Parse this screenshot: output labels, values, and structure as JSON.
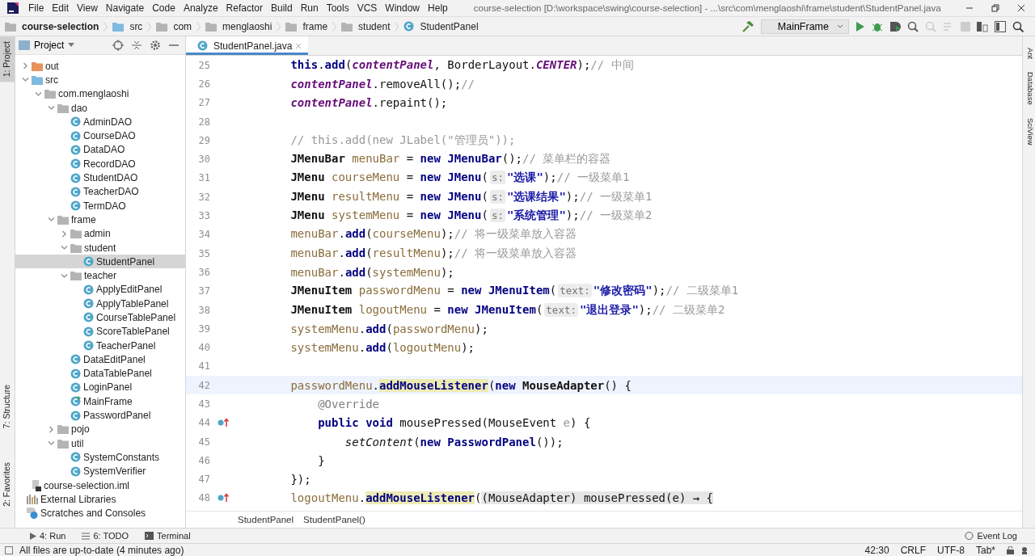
{
  "window": {
    "title": "course-selection [D:\\workspace\\swing\\course-selection] - ...\\src\\com\\menglaoshi\\frame\\student\\StudentPanel.java"
  },
  "menu": [
    "File",
    "Edit",
    "View",
    "Navigate",
    "Code",
    "Analyze",
    "Refactor",
    "Build",
    "Run",
    "Tools",
    "VCS",
    "Window",
    "Help"
  ],
  "breadcrumbs": [
    {
      "label": "course-selection",
      "kind": "project"
    },
    {
      "label": "src",
      "kind": "source"
    },
    {
      "label": "com",
      "kind": "folder"
    },
    {
      "label": "menglaoshi",
      "kind": "folder"
    },
    {
      "label": "frame",
      "kind": "folder"
    },
    {
      "label": "student",
      "kind": "folder"
    },
    {
      "label": "StudentPanel",
      "kind": "class"
    }
  ],
  "run_config": {
    "label": "MainFrame"
  },
  "left_stripe": [
    {
      "label": "1: Project",
      "selected": true
    },
    {
      "label": "7: Structure",
      "selected": false
    },
    {
      "label": "2: Favorites",
      "selected": false
    }
  ],
  "right_stripe": [
    "Ant",
    "Database",
    "SciView"
  ],
  "project_panel": {
    "title": "Project"
  },
  "project_tree": {
    "items": [
      {
        "label": "out",
        "kind": "excluded",
        "expanded": false,
        "selected": false
      },
      {
        "label": "src",
        "kind": "source",
        "expanded": true,
        "selected": false,
        "children": [
          {
            "label": "com.menglaoshi",
            "kind": "package",
            "expanded": true,
            "selected": false,
            "children": [
              {
                "label": "dao",
                "kind": "package",
                "expanded": true,
                "selected": false,
                "children": [
                  {
                    "label": "AdminDAO",
                    "kind": "class",
                    "selected": false
                  },
                  {
                    "label": "CourseDAO",
                    "kind": "class",
                    "selected": false
                  },
                  {
                    "label": "DataDAO",
                    "kind": "class",
                    "selected": false
                  },
                  {
                    "label": "RecordDAO",
                    "kind": "class",
                    "selected": false
                  },
                  {
                    "label": "StudentDAO",
                    "kind": "class",
                    "selected": false
                  },
                  {
                    "label": "TeacherDAO",
                    "kind": "class",
                    "selected": false
                  },
                  {
                    "label": "TermDAO",
                    "kind": "class",
                    "selected": false
                  }
                ]
              },
              {
                "label": "frame",
                "kind": "package",
                "expanded": true,
                "selected": false,
                "children": [
                  {
                    "label": "admin",
                    "kind": "package",
                    "expanded": false,
                    "selected": false
                  },
                  {
                    "label": "student",
                    "kind": "package",
                    "expanded": true,
                    "selected": false,
                    "children": [
                      {
                        "label": "StudentPanel",
                        "kind": "class",
                        "selected": true
                      }
                    ]
                  },
                  {
                    "label": "teacher",
                    "kind": "package",
                    "expanded": true,
                    "selected": false,
                    "children": [
                      {
                        "label": "ApplyEditPanel",
                        "kind": "class",
                        "selected": false
                      },
                      {
                        "label": "ApplyTablePanel",
                        "kind": "class",
                        "selected": false
                      },
                      {
                        "label": "CourseTablePanel",
                        "kind": "class",
                        "selected": false
                      },
                      {
                        "label": "ScoreTablePanel",
                        "kind": "class",
                        "selected": false
                      },
                      {
                        "label": "TeacherPanel",
                        "kind": "class",
                        "selected": false
                      }
                    ]
                  },
                  {
                    "label": "DataEditPanel",
                    "kind": "class",
                    "selected": false
                  },
                  {
                    "label": "DataTablePanel",
                    "kind": "class",
                    "selected": false
                  },
                  {
                    "label": "LoginPanel",
                    "kind": "class",
                    "selected": false
                  },
                  {
                    "label": "MainFrame",
                    "kind": "main-class",
                    "selected": false
                  },
                  {
                    "label": "PasswordPanel",
                    "kind": "class",
                    "selected": false
                  }
                ]
              },
              {
                "label": "pojo",
                "kind": "package",
                "expanded": false,
                "selected": false
              },
              {
                "label": "util",
                "kind": "package",
                "expanded": true,
                "selected": false,
                "children": [
                  {
                    "label": "SystemConstants",
                    "kind": "class",
                    "selected": false
                  },
                  {
                    "label": "SystemVerifier",
                    "kind": "class",
                    "selected": false
                  }
                ]
              }
            ]
          }
        ]
      },
      {
        "label": "course-selection.iml",
        "kind": "module-file",
        "selected": false
      }
    ],
    "other_items": [
      {
        "label": "External Libraries",
        "kind": "libraries",
        "selected": false
      },
      {
        "label": "Scratches and Consoles",
        "kind": "scratches",
        "selected": false
      }
    ]
  },
  "editor_tabs": [
    {
      "label": "StudentPanel.java",
      "selected": true
    }
  ],
  "code": [
    {
      "number": "25",
      "tokens": [
        {
          "kind": "kw",
          "text": "        this"
        },
        {
          "kind": "plain",
          "text": "."
        },
        {
          "kind": "method",
          "text": "add"
        },
        {
          "kind": "plain",
          "text": "("
        },
        {
          "kind": "field",
          "text": "contentPanel"
        },
        {
          "kind": "plain",
          "text": ", BorderLayout."
        },
        {
          "kind": "field",
          "text": "CENTER"
        },
        {
          "kind": "plain",
          "text": ");"
        },
        {
          "kind": "comment",
          "text": "// 中间"
        }
      ]
    },
    {
      "number": "26",
      "tokens": [
        {
          "kind": "field",
          "text": "        contentPanel"
        },
        {
          "kind": "plain",
          "text": ".removeAll();"
        },
        {
          "kind": "comment",
          "text": "//"
        }
      ]
    },
    {
      "number": "27",
      "tokens": [
        {
          "kind": "field",
          "text": "        contentPanel"
        },
        {
          "kind": "plain",
          "text": ".repaint();"
        }
      ]
    },
    {
      "number": "28"
    },
    {
      "number": "29",
      "tokens": [
        {
          "kind": "comment",
          "text": "        // this.add(new JLabel(\"管理员\"));"
        }
      ]
    },
    {
      "number": "30",
      "tokens": [
        {
          "kind": "type",
          "text": "        JMenuBar "
        },
        {
          "kind": "local",
          "text": "menuBar"
        },
        {
          "kind": "plain",
          "text": " = "
        },
        {
          "kind": "kw",
          "text": "new "
        },
        {
          "kind": "ctor",
          "text": "JMenuBar"
        },
        {
          "kind": "plain",
          "text": "();"
        },
        {
          "kind": "comment",
          "text": "// 菜单栏的容器"
        }
      ]
    },
    {
      "number": "31",
      "tokens": [
        {
          "kind": "type",
          "text": "        JMenu "
        },
        {
          "kind": "local",
          "text": "courseMenu"
        },
        {
          "kind": "plain",
          "text": " = "
        },
        {
          "kind": "kw",
          "text": "new "
        },
        {
          "kind": "ctor",
          "text": "JMenu"
        },
        {
          "kind": "plain",
          "text": "("
        },
        {
          "kind": "hint",
          "text": "s:"
        },
        {
          "kind": "str",
          "text": "\"选课\""
        },
        {
          "kind": "plain",
          "text": ");"
        },
        {
          "kind": "comment",
          "text": "// 一级菜单1"
        }
      ]
    },
    {
      "number": "32",
      "tokens": [
        {
          "kind": "type",
          "text": "        JMenu "
        },
        {
          "kind": "local",
          "text": "resultMenu"
        },
        {
          "kind": "plain",
          "text": " = "
        },
        {
          "kind": "kw",
          "text": "new "
        },
        {
          "kind": "ctor",
          "text": "JMenu"
        },
        {
          "kind": "plain",
          "text": "("
        },
        {
          "kind": "hint",
          "text": "s:"
        },
        {
          "kind": "str",
          "text": "\"选课结果\""
        },
        {
          "kind": "plain",
          "text": ");"
        },
        {
          "kind": "comment",
          "text": "// 一级菜单1"
        }
      ]
    },
    {
      "number": "33",
      "tokens": [
        {
          "kind": "type",
          "text": "        JMenu "
        },
        {
          "kind": "local",
          "text": "systemMenu"
        },
        {
          "kind": "plain",
          "text": " = "
        },
        {
          "kind": "kw",
          "text": "new "
        },
        {
          "kind": "ctor",
          "text": "JMenu"
        },
        {
          "kind": "plain",
          "text": "("
        },
        {
          "kind": "hint",
          "text": "s:"
        },
        {
          "kind": "str",
          "text": "\"系统管理\""
        },
        {
          "kind": "plain",
          "text": ");"
        },
        {
          "kind": "comment",
          "text": "// 一级菜单2"
        }
      ]
    },
    {
      "number": "34",
      "tokens": [
        {
          "kind": "local",
          "text": "        menuBar"
        },
        {
          "kind": "plain",
          "text": "."
        },
        {
          "kind": "method",
          "text": "add"
        },
        {
          "kind": "plain",
          "text": "("
        },
        {
          "kind": "local",
          "text": "courseMenu"
        },
        {
          "kind": "plain",
          "text": ");"
        },
        {
          "kind": "comment",
          "text": "// 将一级菜单放入容器"
        }
      ]
    },
    {
      "number": "35",
      "tokens": [
        {
          "kind": "local",
          "text": "        menuBar"
        },
        {
          "kind": "plain",
          "text": "."
        },
        {
          "kind": "method",
          "text": "add"
        },
        {
          "kind": "plain",
          "text": "("
        },
        {
          "kind": "local",
          "text": "resultMenu"
        },
        {
          "kind": "plain",
          "text": ");"
        },
        {
          "kind": "comment",
          "text": "// 将一级菜单放入容器"
        }
      ]
    },
    {
      "number": "36",
      "tokens": [
        {
          "kind": "local",
          "text": "        menuBar"
        },
        {
          "kind": "plain",
          "text": "."
        },
        {
          "kind": "method",
          "text": "add"
        },
        {
          "kind": "plain",
          "text": "("
        },
        {
          "kind": "local",
          "text": "systemMenu"
        },
        {
          "kind": "plain",
          "text": ");"
        }
      ]
    },
    {
      "number": "37",
      "tokens": [
        {
          "kind": "type",
          "text": "        JMenuItem "
        },
        {
          "kind": "local",
          "text": "passwordMenu"
        },
        {
          "kind": "plain",
          "text": " = "
        },
        {
          "kind": "kw",
          "text": "new "
        },
        {
          "kind": "ctor",
          "text": "JMenuItem"
        },
        {
          "kind": "plain",
          "text": "("
        },
        {
          "kind": "hint",
          "text": "text:"
        },
        {
          "kind": "str",
          "text": "\"修改密码\""
        },
        {
          "kind": "plain",
          "text": ");"
        },
        {
          "kind": "comment",
          "text": "// 二级菜单1"
        }
      ]
    },
    {
      "number": "38",
      "tokens": [
        {
          "kind": "type",
          "text": "        JMenuItem "
        },
        {
          "kind": "local",
          "text": "logoutMenu"
        },
        {
          "kind": "plain",
          "text": " = "
        },
        {
          "kind": "kw",
          "text": "new "
        },
        {
          "kind": "ctor",
          "text": "JMenuItem"
        },
        {
          "kind": "plain",
          "text": "("
        },
        {
          "kind": "hint",
          "text": "text:"
        },
        {
          "kind": "str",
          "text": "\"退出登录\""
        },
        {
          "kind": "plain",
          "text": ");"
        },
        {
          "kind": "comment",
          "text": "// 二级菜单2"
        }
      ]
    },
    {
      "number": "39",
      "tokens": [
        {
          "kind": "local",
          "text": "        systemMenu"
        },
        {
          "kind": "plain",
          "text": "."
        },
        {
          "kind": "method",
          "text": "add"
        },
        {
          "kind": "plain",
          "text": "("
        },
        {
          "kind": "local",
          "text": "passwordMenu"
        },
        {
          "kind": "plain",
          "text": ");"
        }
      ]
    },
    {
      "number": "40",
      "tokens": [
        {
          "kind": "local",
          "text": "        systemMenu"
        },
        {
          "kind": "plain",
          "text": "."
        },
        {
          "kind": "method",
          "text": "add"
        },
        {
          "kind": "plain",
          "text": "("
        },
        {
          "kind": "local",
          "text": "logoutMenu"
        },
        {
          "kind": "plain",
          "text": ");"
        }
      ]
    },
    {
      "number": "41"
    },
    {
      "number": "42",
      "current": true,
      "tokens": [
        {
          "kind": "local",
          "text": "        passwordMenu"
        },
        {
          "kind": "plain",
          "text": "."
        },
        {
          "kind": "usage",
          "text": "addMouseListener"
        },
        {
          "kind": "plain",
          "text": "("
        },
        {
          "kind": "kw",
          "text": "new "
        },
        {
          "kind": "type",
          "text": "MouseAdapter"
        },
        {
          "kind": "plain",
          "text": "() {"
        }
      ]
    },
    {
      "number": "43",
      "tokens": [
        {
          "kind": "ann",
          "text": "            @Override"
        }
      ]
    },
    {
      "number": "44",
      "overrides": true,
      "tokens": [
        {
          "kind": "kw",
          "text": "            public void"
        },
        {
          "kind": "plain",
          "text": " mousePressed(MouseEvent "
        },
        {
          "kind": "param",
          "text": "e"
        },
        {
          "kind": "plain",
          "text": ") {"
        }
      ]
    },
    {
      "number": "45",
      "tokens": [
        {
          "kind": "static",
          "text": "                setContent"
        },
        {
          "kind": "plain",
          "text": "("
        },
        {
          "kind": "kw",
          "text": "new "
        },
        {
          "kind": "ctor",
          "text": "PasswordPanel"
        },
        {
          "kind": "plain",
          "text": "());"
        }
      ]
    },
    {
      "number": "46",
      "tokens": [
        {
          "kind": "plain",
          "text": "            }"
        }
      ]
    },
    {
      "number": "47",
      "tokens": [
        {
          "kind": "plain",
          "text": "        });"
        }
      ]
    },
    {
      "number": "48",
      "overrides": true,
      "tokens": [
        {
          "kind": "local",
          "text": "        logoutMenu"
        },
        {
          "kind": "plain",
          "text": "."
        },
        {
          "kind": "usage",
          "text": "addMouseListener"
        },
        {
          "kind": "plain",
          "text": "("
        },
        {
          "kind": "fold",
          "text": "(MouseAdapter) mousePressed(e) → {"
        }
      ]
    }
  ],
  "editor_breadcrumbs": [
    "StudentPanel",
    "StudentPanel()"
  ],
  "tool_tabs": [
    {
      "label": "4: Run",
      "kind": "run"
    },
    {
      "label": "6: TODO",
      "kind": "todo"
    },
    {
      "label": "Terminal",
      "kind": "terminal"
    }
  ],
  "event_log": "Event Log",
  "status_bar": {
    "message": "All files are up-to-date (4 minutes ago)",
    "position": "42:30",
    "line_separator": "CRLF",
    "encoding": "UTF-8",
    "indent": "Tab*"
  }
}
